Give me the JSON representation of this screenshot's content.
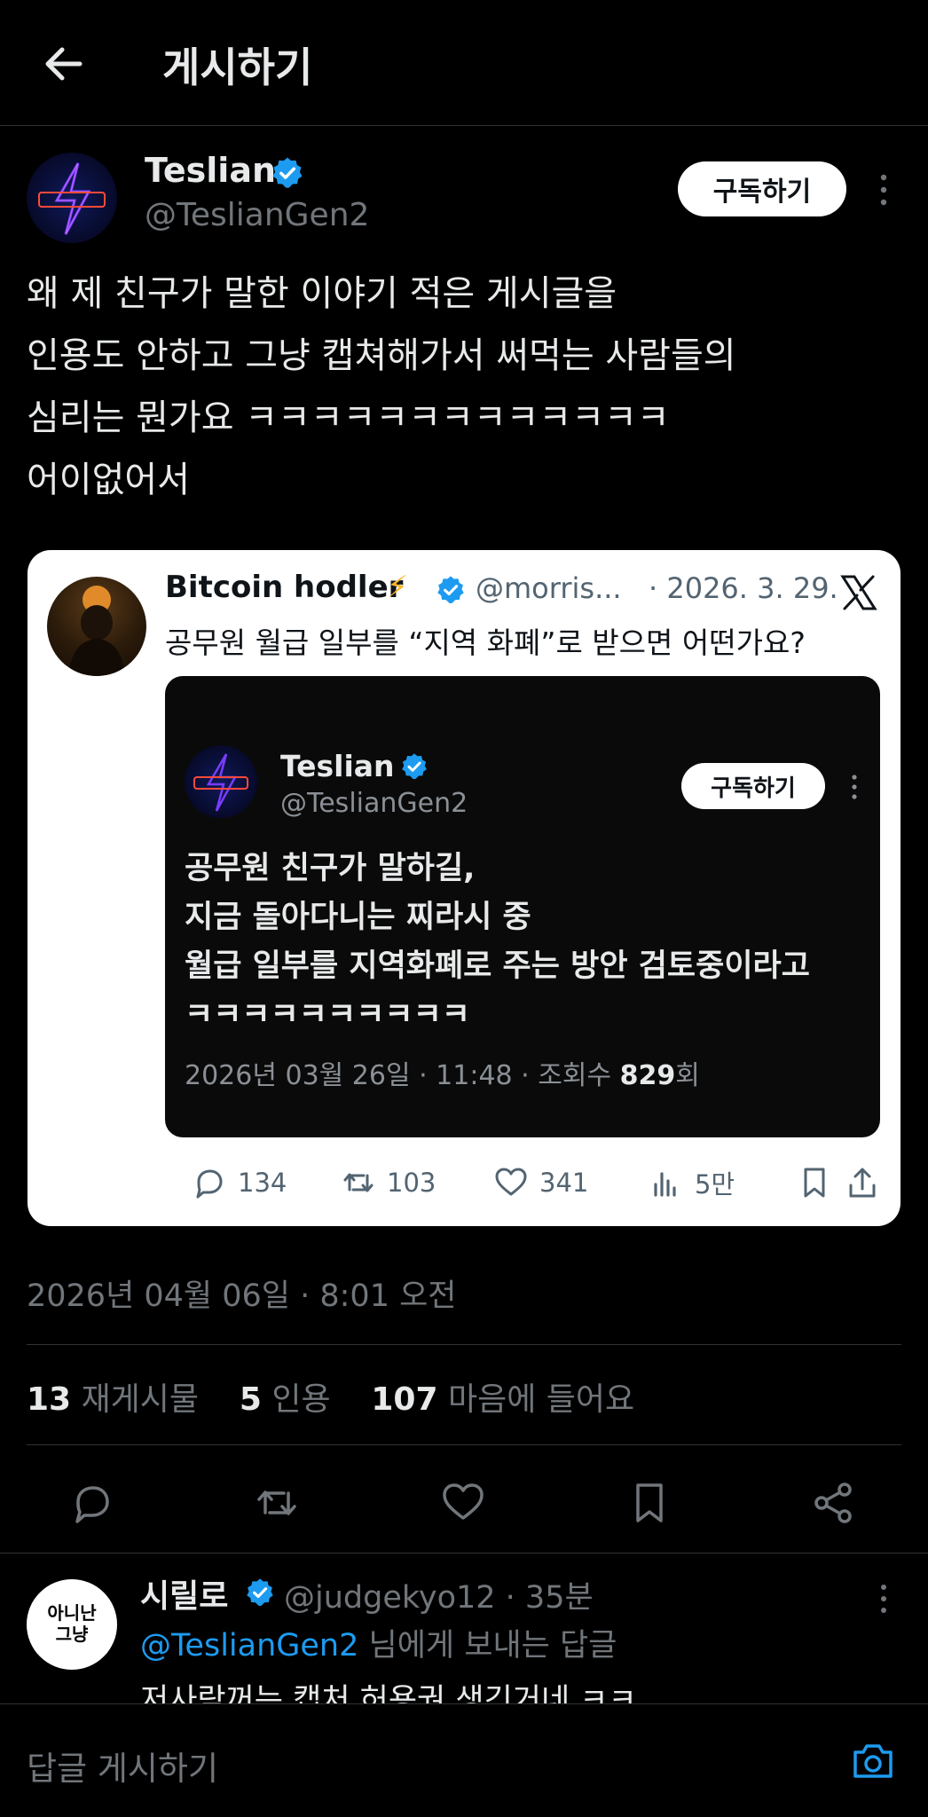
{
  "header": {
    "title": "게시하기"
  },
  "post": {
    "author_name": "Teslian",
    "author_handle": "@TeslianGen2",
    "subscribe_label": "구독하기",
    "text_lines": [
      "왜 제 친구가 말한 이야기 적은 게시글을",
      "인용도 안하고 그냥 캡쳐해가서 써먹는 사람들의",
      "심리는 뭔가요 ㅋㅋㅋㅋㅋㅋㅋㅋㅋㅋㅋㅋㅋ",
      "어이없어서"
    ],
    "timestamp": "2026년 04월 06일 · 8:01 오전"
  },
  "quote": {
    "author_name": "Bitcoin hodler",
    "author_emoji": "⚡",
    "author_handle": "@morris...",
    "date": "· 2026. 3. 29.",
    "text": "공무원 월급 일부를 “지역 화폐”로 받으면 어떤가요?",
    "image": {
      "author_name": "Teslian",
      "author_handle": "@TeslianGen2",
      "subscribe_label": "구독하기",
      "text_lines": [
        "공무원 친구가 말하길,",
        "지금 돌아다니는 찌라시 중",
        "월급 일부를 지역화폐로 주는 방안 검토중이라고",
        "ㅋㅋㅋㅋㅋㅋㅋㅋㅋㅋ"
      ],
      "meta_prefix": "2026년 03월 26일 · 11:48 · 조회수 ",
      "meta_views": "829",
      "meta_suffix": "회"
    },
    "actions": {
      "replies": "134",
      "reposts": "103",
      "likes": "341",
      "views": "5만"
    }
  },
  "stats": {
    "reposts_count": "13",
    "reposts_label": "재게시물",
    "quotes_count": "5",
    "quotes_label": "인용",
    "likes_count": "107",
    "likes_label": "마음에 들어요"
  },
  "reply": {
    "avatar_line1": "아니난",
    "avatar_line2": "그냥",
    "author_name": "시릴로",
    "author_handle": "@judgekyo12 · 35분",
    "replying_mention": "@TeslianGen2",
    "replying_suffix": " 님에게 보내는 답글",
    "text": "저사람꺼는 캡처 허용권 생긴거네 ㅋㅋ"
  },
  "composer": {
    "placeholder": "답글 게시하기"
  },
  "colors": {
    "background": "#000000",
    "accent": "#1d9bf0",
    "muted": "#71767b",
    "bolt": "#f7b52c"
  }
}
